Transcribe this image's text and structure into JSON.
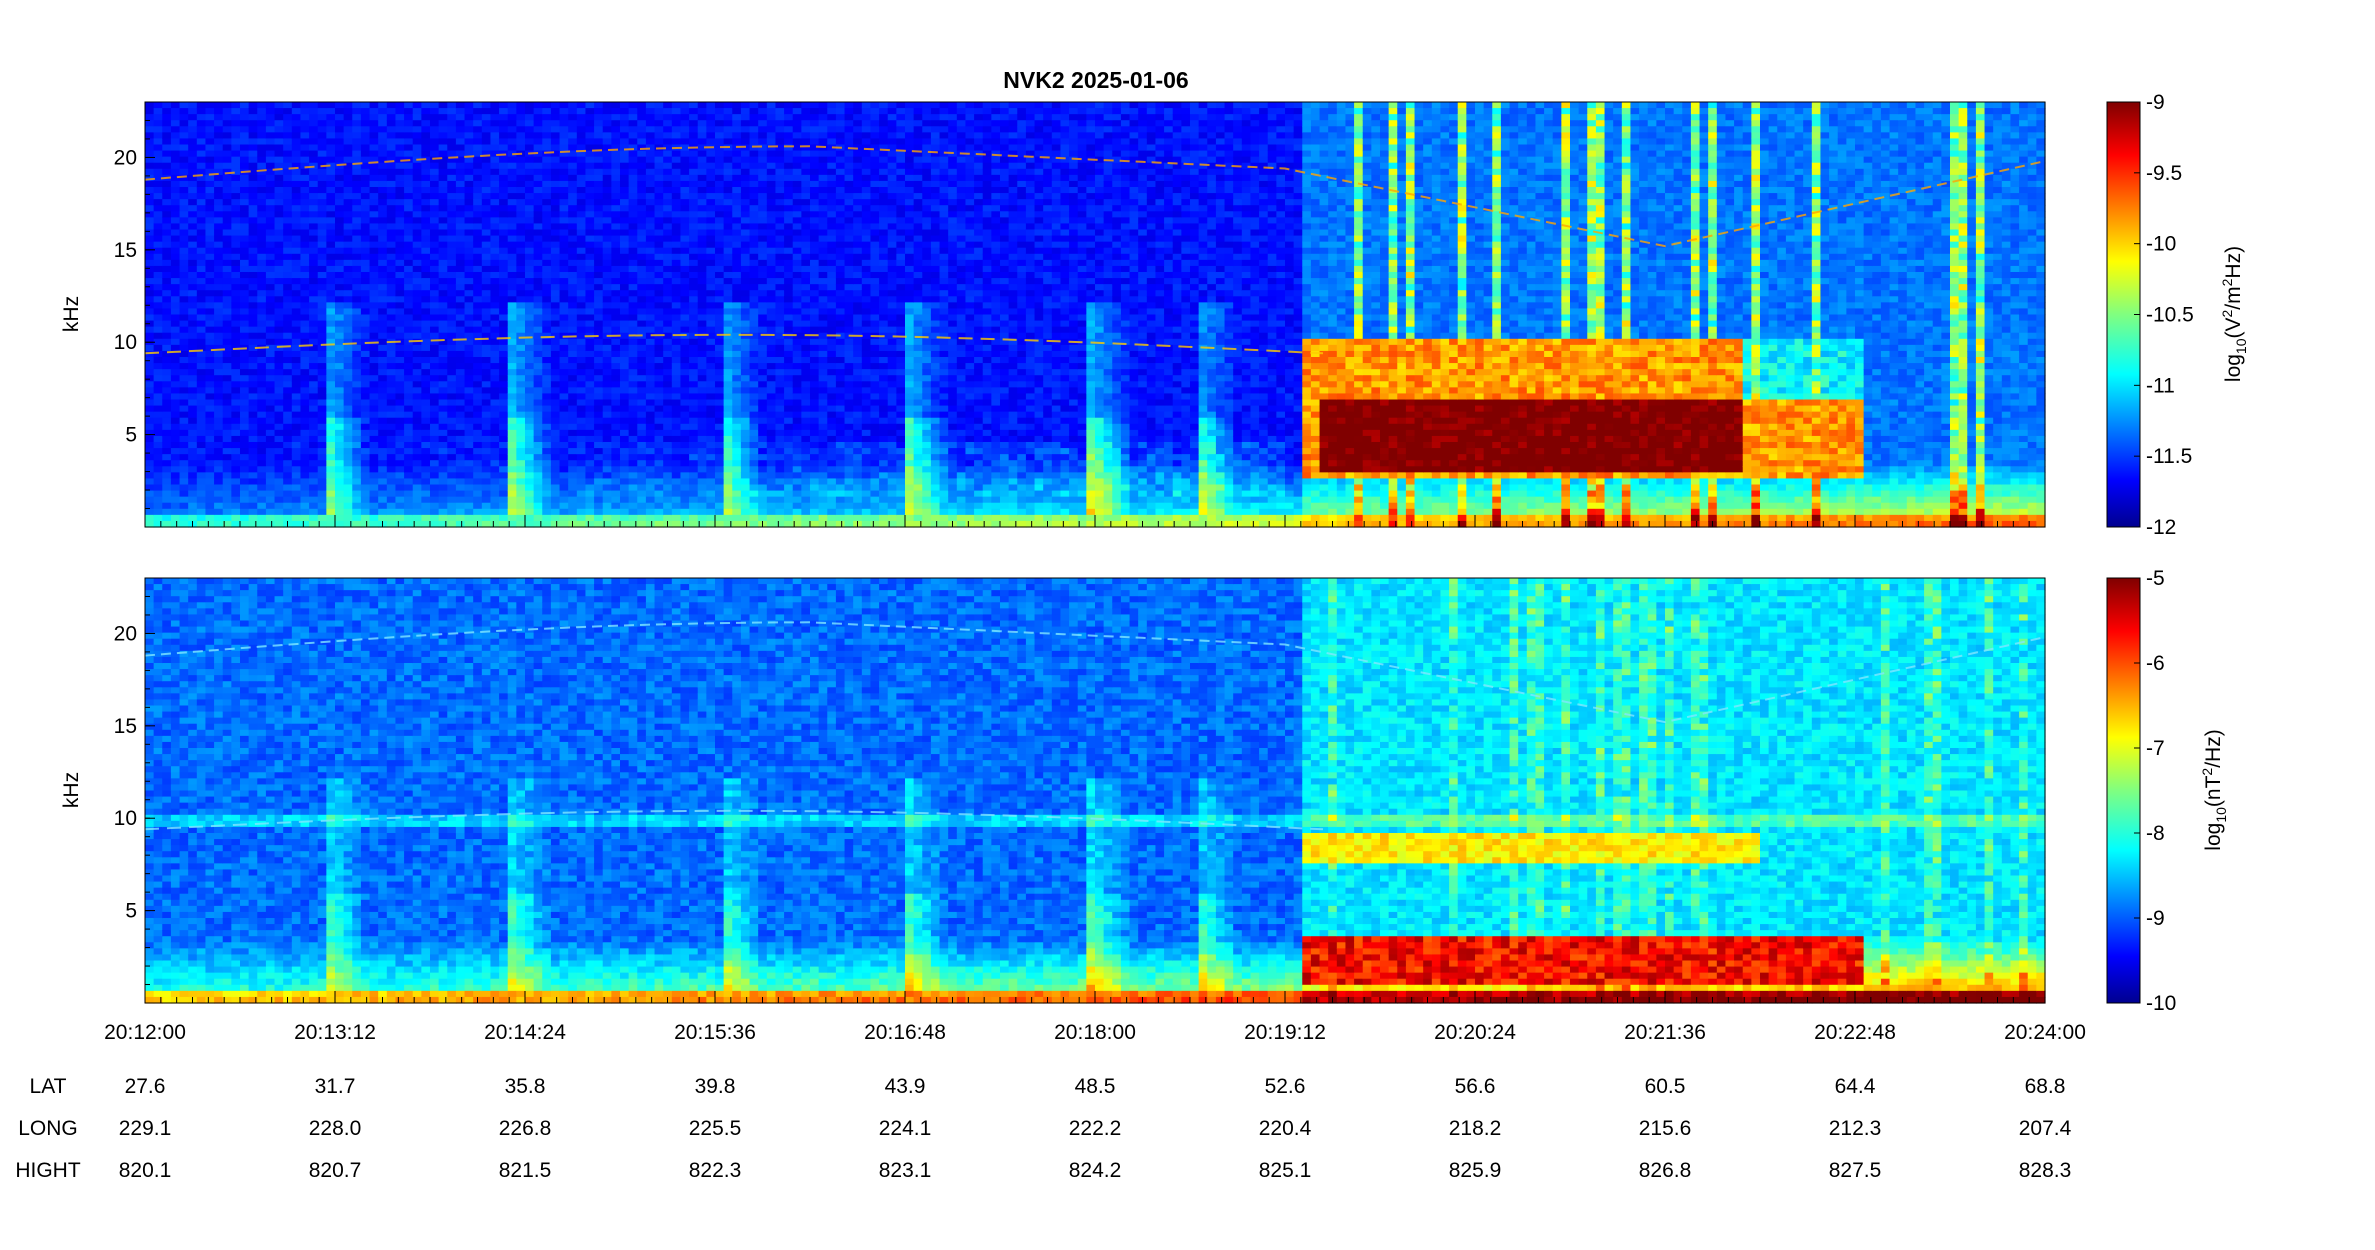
{
  "title": "NVK2 2025-01-06",
  "chart_data": [
    {
      "type": "heatmap",
      "panel": "electric field spectrogram",
      "ylabel": "kHz",
      "ylim": [
        0,
        23
      ],
      "yticks": [
        "5",
        "10",
        "15",
        "20"
      ],
      "xlim": [
        "20:12:00",
        "20:24:00"
      ],
      "colorbar": {
        "label_main": "log",
        "label_sub": "10",
        "label_unit_open": "(V",
        "label_unit_sup1": "2",
        "label_unit_mid": "/m",
        "label_unit_sup2": "2",
        "label_unit_close": "Hz)",
        "range": [
          -12,
          -9
        ],
        "ticks": [
          "-9",
          "-9.5",
          "-10",
          "-10.5",
          "-11",
          "-11.5",
          "-12"
        ]
      },
      "features": [
        {
          "name": "transmitter line",
          "freq_khz_start": 18.8,
          "freq_khz_peak": 20.6,
          "freq_khz_end": 15.2
        },
        {
          "name": "transmitter line",
          "freq_khz_start": 9.4,
          "freq_khz_peak": 10.4,
          "freq_khz_end": 9.6
        },
        {
          "name": "intense emission band",
          "time_start": "20:19:20",
          "time_end": "20:22:50",
          "freq_khz_low": 2.5,
          "freq_khz_high": 10.2,
          "level": -9.1
        },
        {
          "name": "whistlers",
          "times": [
            "20:13:10",
            "20:14:20",
            "20:15:40",
            "20:16:50",
            "20:18:00",
            "20:18:40"
          ]
        }
      ]
    },
    {
      "type": "heatmap",
      "panel": "magnetic field spectrogram",
      "ylabel": "kHz",
      "ylim": [
        0,
        23
      ],
      "yticks": [
        "5",
        "10",
        "15",
        "20"
      ],
      "xlim": [
        "20:12:00",
        "20:24:00"
      ],
      "colorbar": {
        "label_main": "log",
        "label_sub": "10",
        "label_unit_open": "(nT",
        "label_unit_sup1": "2",
        "label_unit_close": "/Hz)",
        "range": [
          -10,
          -5
        ],
        "ticks": [
          "-5",
          "-6",
          "-7",
          "-8",
          "-9",
          "-10"
        ]
      },
      "features": [
        {
          "name": "intense band",
          "time_start": "20:19:20",
          "time_end": "20:22:50",
          "freq_khz_low": 1.0,
          "freq_khz_high": 3.5,
          "level": -5.6
        },
        {
          "name": "secondary band",
          "time_start": "20:19:20",
          "time_end": "20:21:50",
          "freq_khz_low": 7.5,
          "freq_khz_high": 9.3,
          "level": -6.8
        }
      ]
    }
  ],
  "x_axis": {
    "ticks": [
      "20:12:00",
      "20:13:12",
      "20:14:24",
      "20:15:36",
      "20:16:48",
      "20:18:00",
      "20:19:12",
      "20:20:24",
      "20:21:36",
      "20:22:48",
      "20:24:00"
    ]
  },
  "orbit_table": {
    "rows": [
      {
        "label": "LAT",
        "values": [
          "27.6",
          "31.7",
          "35.8",
          "39.8",
          "43.9",
          "48.5",
          "52.6",
          "56.6",
          "60.5",
          "64.4",
          "68.8"
        ]
      },
      {
        "label": "LONG",
        "values": [
          "229.1",
          "228.0",
          "226.8",
          "225.5",
          "224.1",
          "222.2",
          "220.4",
          "218.2",
          "215.6",
          "212.3",
          "207.4"
        ]
      },
      {
        "label": "HIGHT",
        "values": [
          "820.1",
          "820.7",
          "821.5",
          "822.3",
          "823.1",
          "824.2",
          "825.1",
          "825.9",
          "826.8",
          "827.5",
          "828.3"
        ]
      }
    ]
  },
  "colors": {
    "jet_low": "#00008f",
    "jet_high": "#800000",
    "background": "#ffffff"
  }
}
